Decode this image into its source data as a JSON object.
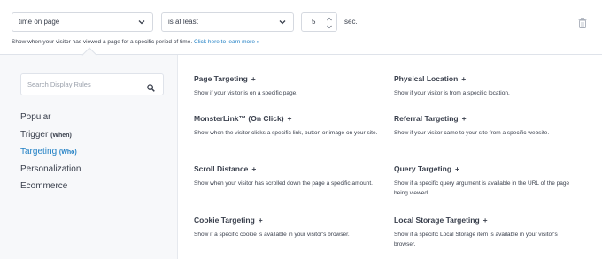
{
  "rule": {
    "condition": "time on page",
    "operator": "is at least",
    "value": "5",
    "unit": "sec.",
    "help_text": "Show when your visitor has viewed a page for a specific period of time.",
    "help_link": "Click here to learn more »"
  },
  "search": {
    "placeholder": "Search Display Rules"
  },
  "categories": [
    {
      "label": "Popular",
      "sub": ""
    },
    {
      "label": "Trigger",
      "sub": "(When)"
    },
    {
      "label": "Targeting",
      "sub": "(Who)"
    },
    {
      "label": "Personalization",
      "sub": ""
    },
    {
      "label": "Ecommerce",
      "sub": ""
    }
  ],
  "active_category": "Targeting",
  "rules": [
    {
      "title": "Page Targeting",
      "desc": "Show if your visitor is on a specific page."
    },
    {
      "title": "Physical Location",
      "desc": "Show if your visitor is from a specific location."
    },
    {
      "title": "MonsterLink™ (On Click)",
      "desc": "Show when the visitor clicks a specific link, button or image on your site."
    },
    {
      "title": "Referral Targeting",
      "desc": "Show if your visitor came to your site from a specific website."
    },
    {
      "title": "Scroll Distance",
      "desc": "Show when your visitor has scrolled down the page a specific amount."
    },
    {
      "title": "Query Targeting",
      "desc": "Show if a specific query argument is available in the URL of the page being viewed."
    },
    {
      "title": "Cookie Targeting",
      "desc": "Show if a specific cookie is available in your visitor's browser."
    },
    {
      "title": "Local Storage Targeting",
      "desc": "Show if a specific Local Storage item is available in your visitor's browser."
    }
  ],
  "add_symbol": "+",
  "icons": {
    "chevron": "chevron-down-icon",
    "trash": "trash-icon",
    "search": "search-icon",
    "spinner": "number-spinner-icon"
  },
  "colors": {
    "accent": "#1f7fc4",
    "text": "#393f4c",
    "sidebar_bg": "#f7f8fa"
  }
}
